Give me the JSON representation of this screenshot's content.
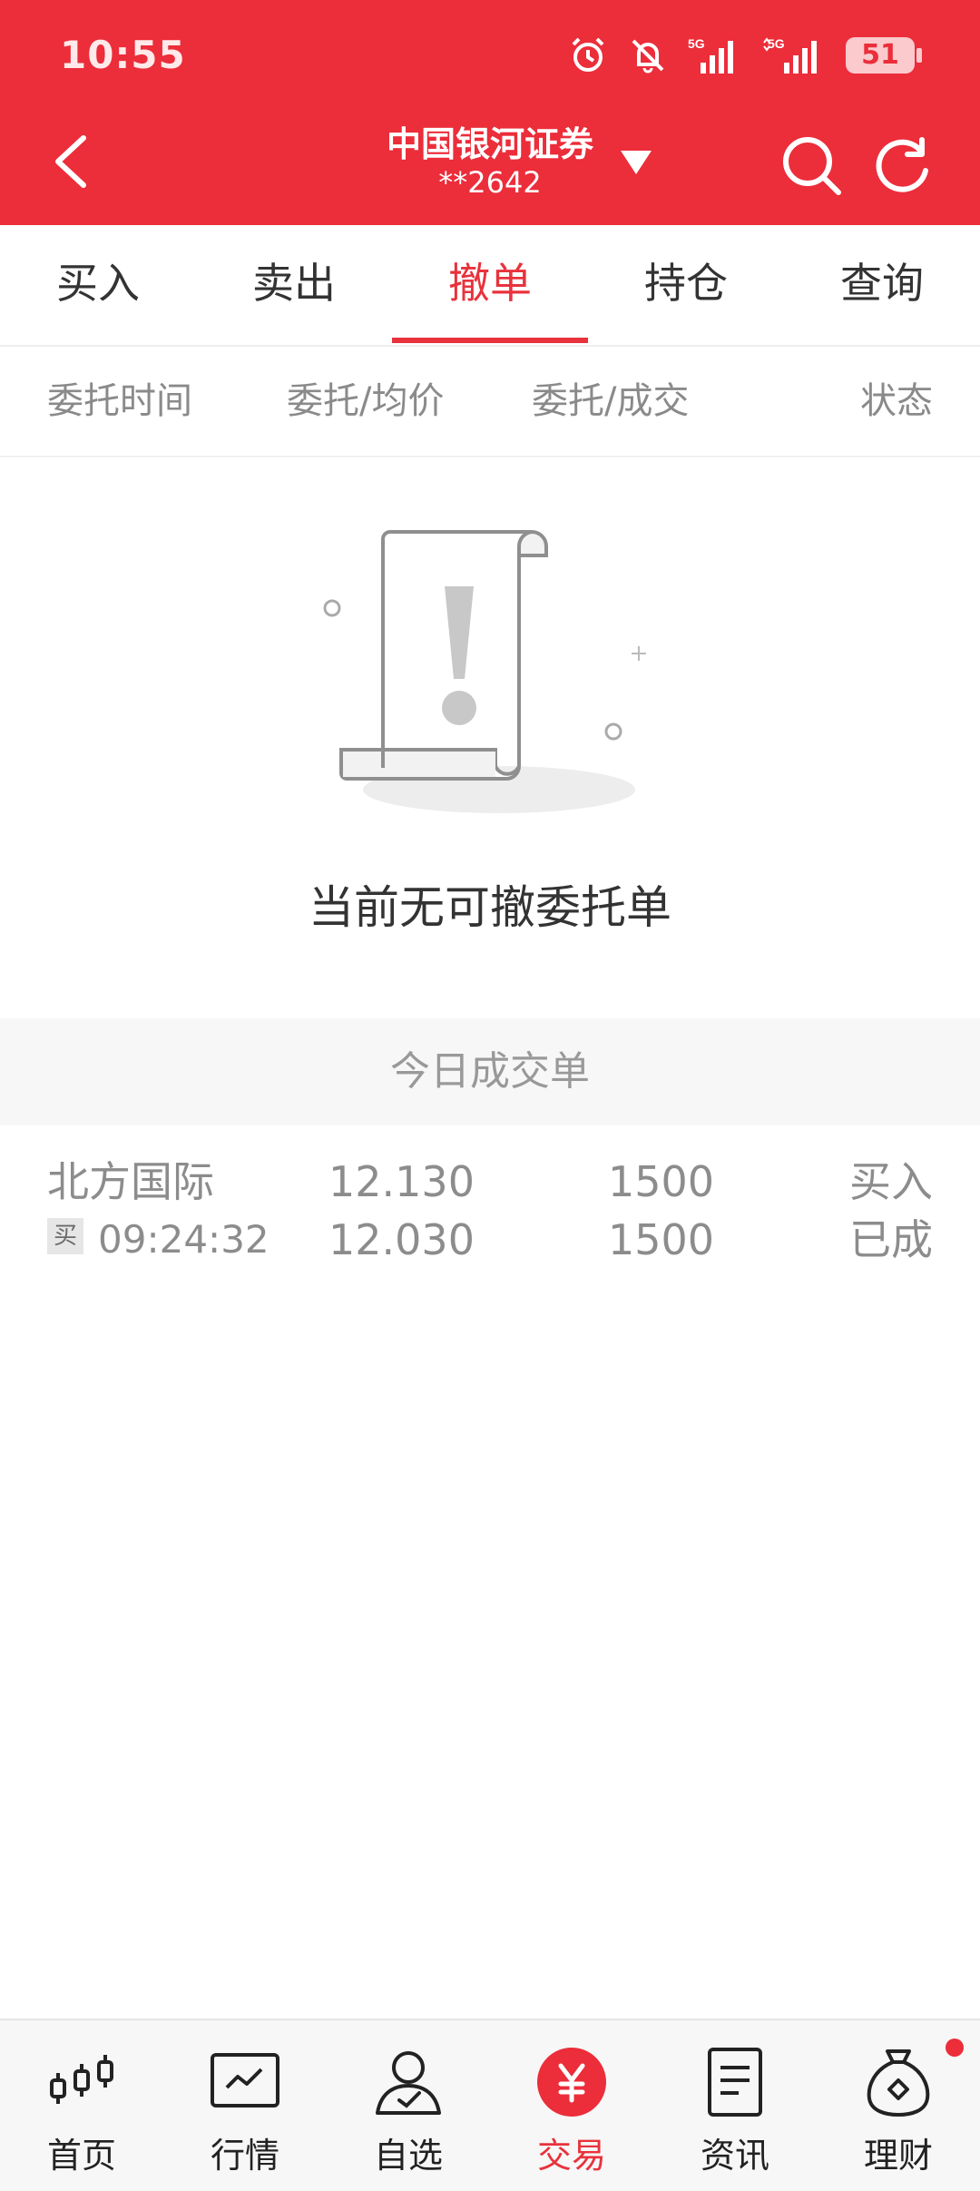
{
  "status_bar": {
    "time": "10:55",
    "battery": "51",
    "icons": [
      "alarm-icon",
      "bell-off-icon",
      "5g-signal-icon",
      "5g-signal-icon"
    ]
  },
  "header": {
    "broker": "中国银河证券",
    "account": "**2642",
    "icons": [
      "back-icon",
      "dropdown-icon",
      "search-icon",
      "refresh-icon"
    ]
  },
  "tabs": [
    {
      "label": "买入"
    },
    {
      "label": "卖出"
    },
    {
      "label": "撤单"
    },
    {
      "label": "持仓"
    },
    {
      "label": "查询"
    }
  ],
  "columns": [
    {
      "label": "委托时间"
    },
    {
      "label": "委托/均价"
    },
    {
      "label": "委托/成交"
    },
    {
      "label": "状态"
    }
  ],
  "empty_state": {
    "text": "当前无可撤委托单",
    "icon": "empty-document-icon"
  },
  "today_trades": {
    "title": "今日成交单",
    "rows": [
      {
        "name": "北方国际",
        "badge": "买",
        "time": "09:24:32",
        "order_price": "12.130",
        "avg_price": "12.030",
        "order_qty": "1500",
        "filled_qty": "1500",
        "direction": "买入",
        "status": "已成"
      }
    ]
  },
  "bottom_nav": [
    {
      "label": "首页",
      "icon": "candlestick-icon"
    },
    {
      "label": "行情",
      "icon": "chart-trend-icon"
    },
    {
      "label": "自选",
      "icon": "user-check-icon"
    },
    {
      "label": "交易",
      "icon": "yen-icon",
      "active": true
    },
    {
      "label": "资讯",
      "icon": "document-icon"
    },
    {
      "label": "理财",
      "icon": "money-bag-icon",
      "badge": "dot"
    }
  ],
  "colors": {
    "brand": "#ec2d3a",
    "active_tab": "#e8323c"
  }
}
